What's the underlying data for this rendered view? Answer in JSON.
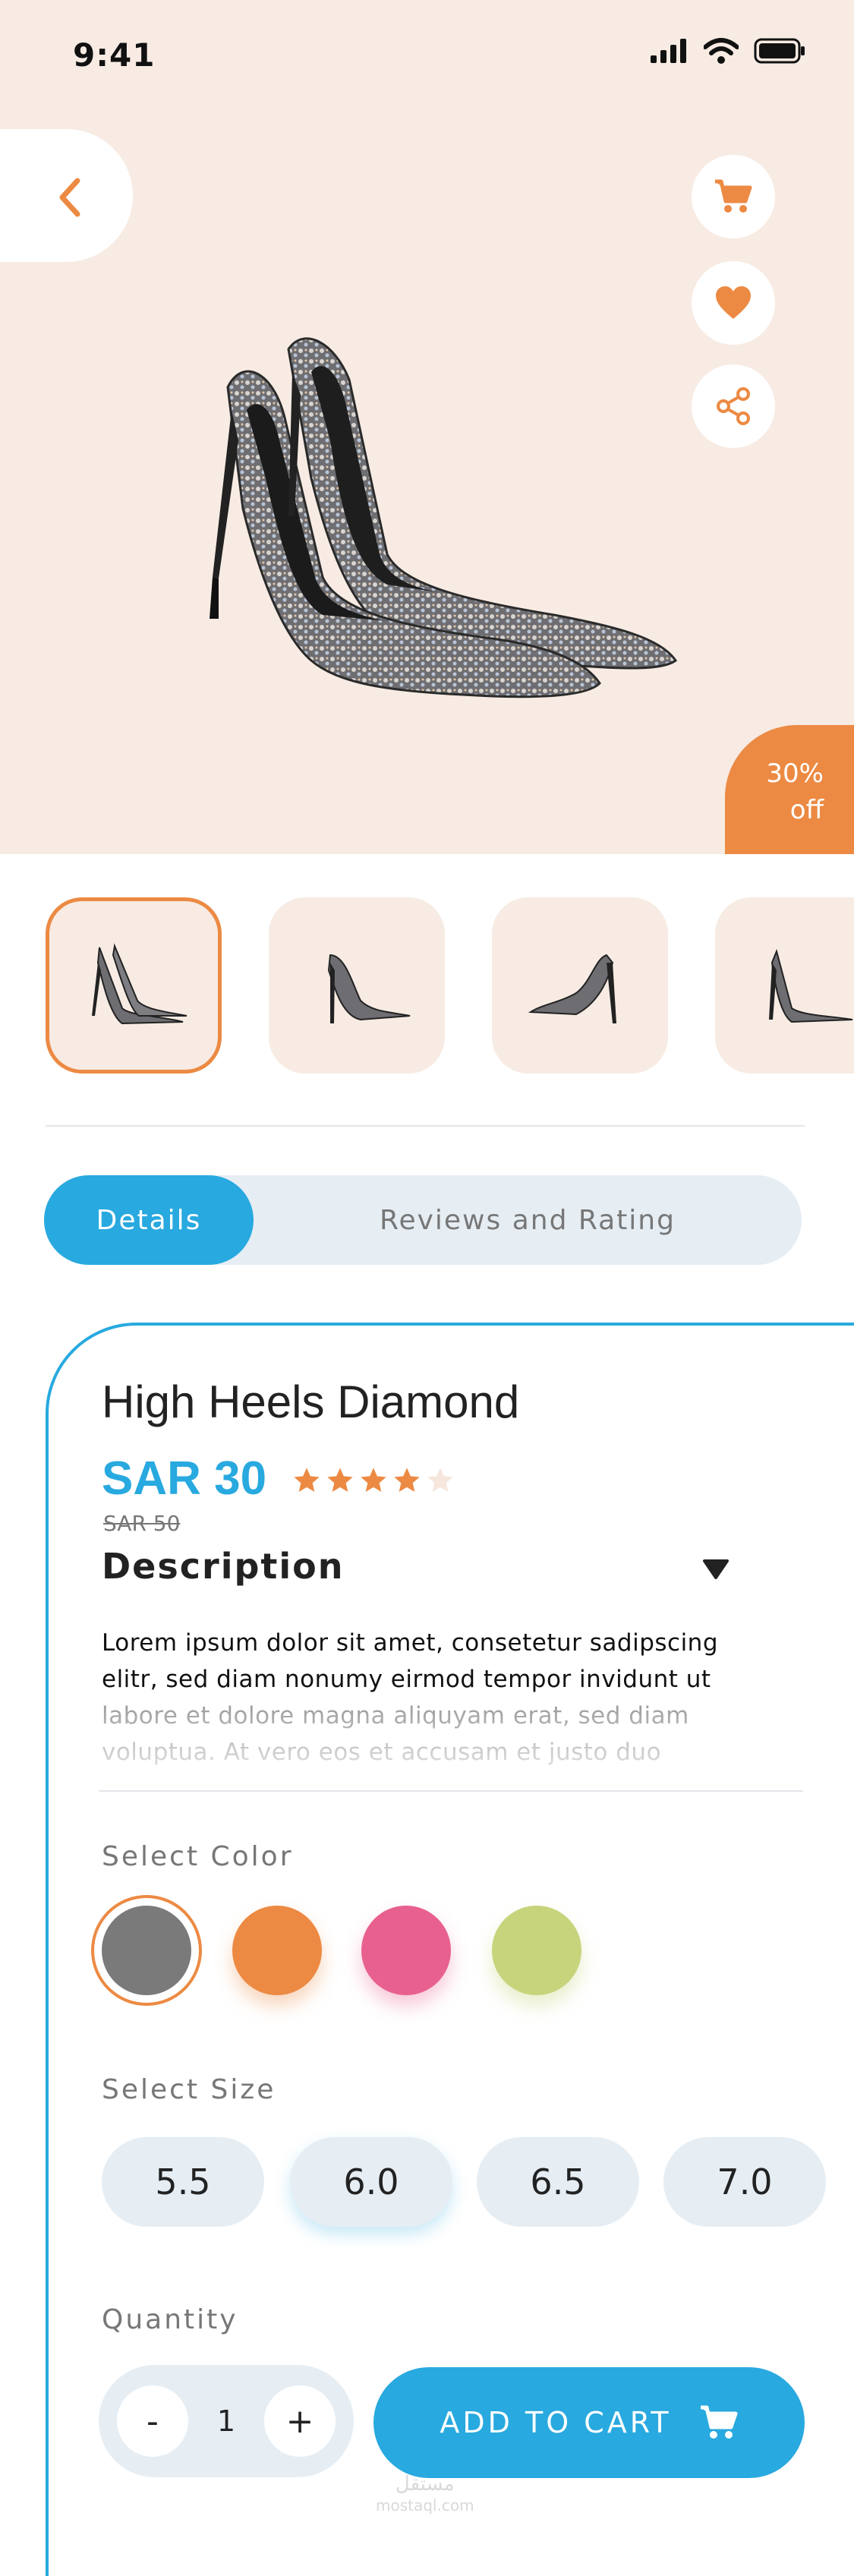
{
  "status": {
    "time": "9:41"
  },
  "product": {
    "discount": "30%",
    "discount_suffix": "off",
    "title": "High Heels Diamond",
    "price": "SAR 30",
    "old_price": "SAR 50",
    "rating": 4,
    "rating_max": 5
  },
  "tabs": {
    "details": "Details",
    "reviews": "Reviews and Rating"
  },
  "description": {
    "heading": "Description",
    "text": "Lorem ipsum dolor sit amet, consetetur sadipscing elitr, sed diam nonumy eirmod tempor invidunt ut labore et dolore magna aliquyam erat, sed diam voluptua. At vero eos et accusam et justo duo"
  },
  "color": {
    "label": "Select Color",
    "options": [
      "#7a7a7a",
      "#ec8a43",
      "#e8608f",
      "#c8d47c"
    ],
    "selected_index": 0
  },
  "size": {
    "label": "Select Size",
    "options": [
      "5.5",
      "6.0",
      "6.5",
      "7.0"
    ],
    "selected": "6.0"
  },
  "quantity": {
    "label": "Quantity",
    "minus": "-",
    "plus": "+",
    "value": "1"
  },
  "cart_button": {
    "label": "ADD TO CART"
  },
  "watermark": {
    "line1": "مستقل",
    "line2": "mostaql.com"
  },
  "icons": [
    "cart-icon",
    "heart-icon",
    "share-icon",
    "back-arrow-icon"
  ],
  "colors": {
    "accent": "#28a9df",
    "orange": "#ec8a43",
    "hero_bg": "#f7ebe3",
    "chip_bg": "#e6eef4"
  }
}
